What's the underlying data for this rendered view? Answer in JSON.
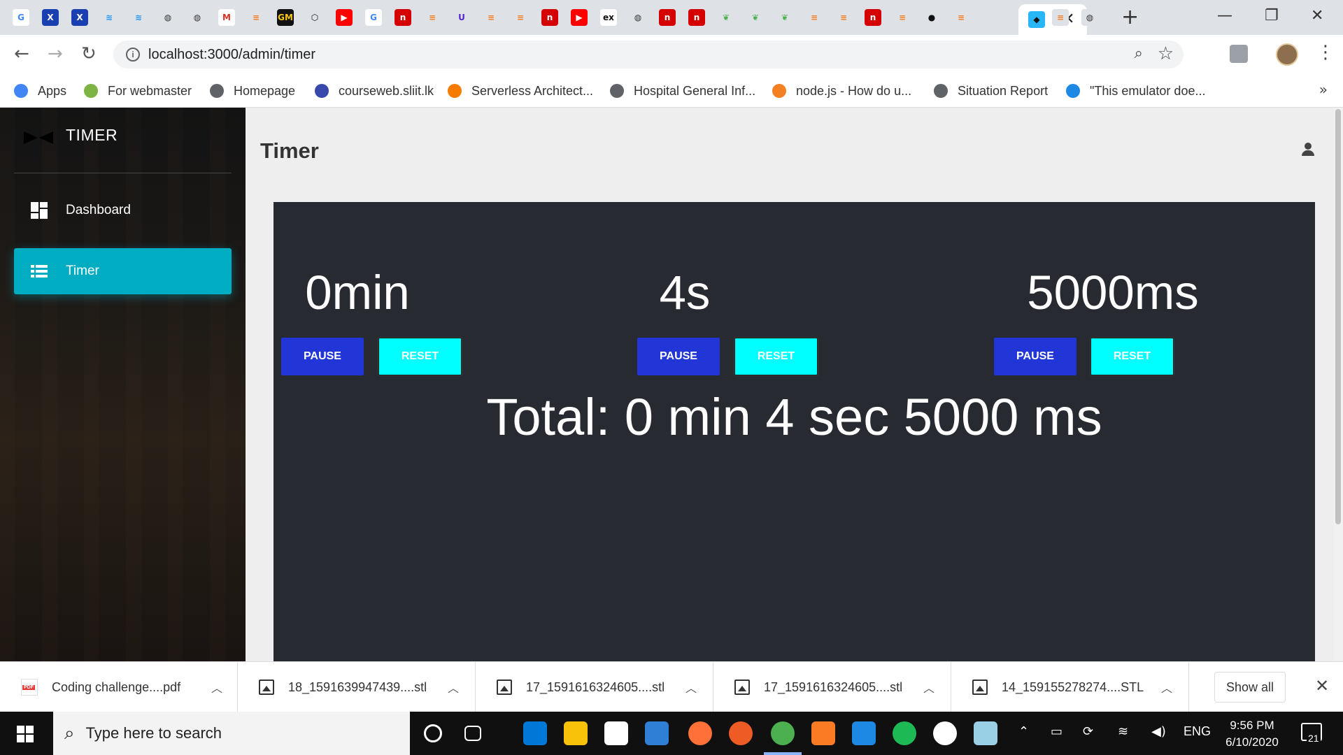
{
  "browser": {
    "url": "localhost:3000/admin/timer",
    "favicons": [
      {
        "name": "google-icon",
        "glyph": "G",
        "bg": "#ffffff",
        "fg": "#4285f4"
      },
      {
        "name": "xda-icon",
        "glyph": "X",
        "bg": "#1a3fb0",
        "fg": "#ffffff"
      },
      {
        "name": "xda-icon",
        "glyph": "X",
        "bg": "#1a3fb0",
        "fg": "#ffffff"
      },
      {
        "name": "mui-icon",
        "glyph": "≋",
        "bg": "#dee1e6",
        "fg": "#2196f3"
      },
      {
        "name": "mui-icon",
        "glyph": "≋",
        "bg": "#dee1e6",
        "fg": "#2196f3"
      },
      {
        "name": "globe-icon",
        "glyph": "◍",
        "bg": "#dee1e6",
        "fg": "#333333"
      },
      {
        "name": "globe-icon",
        "glyph": "◍",
        "bg": "#dee1e6",
        "fg": "#333333"
      },
      {
        "name": "gmail-icon",
        "glyph": "M",
        "bg": "#ffffff",
        "fg": "#d93025"
      },
      {
        "name": "stackoverflow-icon",
        "glyph": "≡",
        "bg": "#dee1e6",
        "fg": "#f48024"
      },
      {
        "name": "gm-icon",
        "glyph": "GM",
        "bg": "#111111",
        "fg": "#f5c518"
      },
      {
        "name": "codesandbox-icon",
        "glyph": "⬡",
        "bg": "#dee1e6",
        "fg": "#111111"
      },
      {
        "name": "youtube-icon",
        "glyph": "▶",
        "bg": "#ff0000",
        "fg": "#ffffff"
      },
      {
        "name": "google-icon",
        "glyph": "G",
        "bg": "#ffffff",
        "fg": "#4285f4"
      },
      {
        "name": "n-icon",
        "glyph": "n",
        "bg": "#d50000",
        "fg": "#ffffff"
      },
      {
        "name": "stackoverflow-icon",
        "glyph": "≡",
        "bg": "#dee1e6",
        "fg": "#f48024"
      },
      {
        "name": "udemy-icon",
        "glyph": "U",
        "bg": "#dee1e6",
        "fg": "#5624d0"
      },
      {
        "name": "stackoverflow-icon",
        "glyph": "≡",
        "bg": "#dee1e6",
        "fg": "#f48024"
      },
      {
        "name": "stackoverflow-icon",
        "glyph": "≡",
        "bg": "#dee1e6",
        "fg": "#f48024"
      },
      {
        "name": "n-icon",
        "glyph": "n",
        "bg": "#d50000",
        "fg": "#ffffff"
      },
      {
        "name": "youtube-icon",
        "glyph": "▶",
        "bg": "#ff0000",
        "fg": "#ffffff"
      },
      {
        "name": "ex-icon",
        "glyph": "ex",
        "bg": "#ffffff",
        "fg": "#111111"
      },
      {
        "name": "globe-icon",
        "glyph": "◍",
        "bg": "#dee1e6",
        "fg": "#333333"
      },
      {
        "name": "n-icon",
        "glyph": "n",
        "bg": "#d50000",
        "fg": "#ffffff"
      },
      {
        "name": "n-icon",
        "glyph": "n",
        "bg": "#d50000",
        "fg": "#ffffff"
      },
      {
        "name": "mongodb-icon",
        "glyph": "❦",
        "bg": "#dee1e6",
        "fg": "#4caf50"
      },
      {
        "name": "mongodb-icon",
        "glyph": "❦",
        "bg": "#dee1e6",
        "fg": "#4caf50"
      },
      {
        "name": "mongodb-icon",
        "glyph": "❦",
        "bg": "#dee1e6",
        "fg": "#4caf50"
      },
      {
        "name": "stackoverflow-icon",
        "glyph": "≡",
        "bg": "#dee1e6",
        "fg": "#f48024"
      },
      {
        "name": "stackoverflow-icon",
        "glyph": "≡",
        "bg": "#dee1e6",
        "fg": "#f48024"
      },
      {
        "name": "n-icon",
        "glyph": "n",
        "bg": "#d50000",
        "fg": "#ffffff"
      },
      {
        "name": "stackoverflow-icon",
        "glyph": "≡",
        "bg": "#dee1e6",
        "fg": "#f48024"
      },
      {
        "name": "github-icon",
        "glyph": "●",
        "bg": "#dee1e6",
        "fg": "#111111"
      },
      {
        "name": "stackoverflow-icon",
        "glyph": "≡",
        "bg": "#dee1e6",
        "fg": "#f48024"
      }
    ],
    "active_tab_icon": {
      "name": "app-favicon-icon",
      "glyph": "◆",
      "bg": "#29b6f6",
      "fg": "#111111"
    },
    "after_tabs": [
      {
        "name": "stackoverflow-icon",
        "glyph": "≡",
        "bg": "#dee1e6",
        "fg": "#f48024"
      },
      {
        "name": "globe-icon",
        "glyph": "◍",
        "bg": "#dee1e6",
        "fg": "#333333"
      }
    ],
    "bookmarks": [
      {
        "label": "Apps",
        "color": "#4285f4"
      },
      {
        "label": "For webmaster",
        "color": "#7cb342"
      },
      {
        "label": "Homepage",
        "color": "#5f6368"
      },
      {
        "label": "courseweb.sliit.lk",
        "color": "#3949ab"
      },
      {
        "label": "Serverless Architect...",
        "color": "#f57c00"
      },
      {
        "label": "Hospital General Inf...",
        "color": "#5f6368"
      },
      {
        "label": "node.js - How do u...",
        "color": "#f48024"
      },
      {
        "label": "Situation Report",
        "color": "#5f6368"
      },
      {
        "label": "\"This emulator doe...",
        "color": "#1e88e5"
      }
    ]
  },
  "sidebar": {
    "brand": "TIMER",
    "items": [
      {
        "label": "Dashboard",
        "active": false
      },
      {
        "label": "Timer",
        "active": true
      }
    ]
  },
  "main": {
    "title": "Timer",
    "timers": [
      {
        "value": "0min",
        "pause_label": "PAUSE",
        "reset_label": "RESET"
      },
      {
        "value": "4s",
        "pause_label": "PAUSE",
        "reset_label": "RESET"
      },
      {
        "value": "5000ms",
        "pause_label": "PAUSE",
        "reset_label": "RESET"
      }
    ],
    "total": "Total: 0 min 4 sec 5000 ms"
  },
  "downloads": {
    "items": [
      {
        "name": "Coding challenge....pdf",
        "type": "pdf"
      },
      {
        "name": "18_1591639947439....stl",
        "type": "file"
      },
      {
        "name": "17_1591616324605....stl",
        "type": "file"
      },
      {
        "name": "17_1591616324605....stl",
        "type": "file"
      },
      {
        "name": "14_159155278274....STL",
        "type": "file"
      }
    ],
    "show_all_label": "Show all"
  },
  "taskbar": {
    "search_placeholder": "Type here to search",
    "apps": [
      {
        "name": "cortana-icon",
        "color": "#101010"
      },
      {
        "name": "task-view-icon",
        "color": "#101010"
      },
      {
        "name": "edge-icon",
        "color": "#0078d7"
      },
      {
        "name": "file-explorer-icon",
        "color": "#f9c20a"
      },
      {
        "name": "store-icon",
        "color": "#ffffff"
      },
      {
        "name": "mail-icon",
        "color": "#2f7fd6"
      },
      {
        "name": "firefox-icon",
        "color": "#ff7139"
      },
      {
        "name": "postman-icon",
        "color": "#ef5b25"
      },
      {
        "name": "chrome-icon",
        "color": "#4caf50"
      },
      {
        "name": "xampp-icon",
        "color": "#fb7a24"
      },
      {
        "name": "vscode-icon",
        "color": "#1e88e5"
      },
      {
        "name": "spotify-icon",
        "color": "#1db954"
      },
      {
        "name": "mongodb-compass-icon",
        "color": "#ffffff"
      },
      {
        "name": "notes-icon",
        "color": "#9ad0e6"
      }
    ],
    "language": "ENG",
    "time": "9:56 PM",
    "date": "6/10/2020",
    "notifications": "21"
  }
}
